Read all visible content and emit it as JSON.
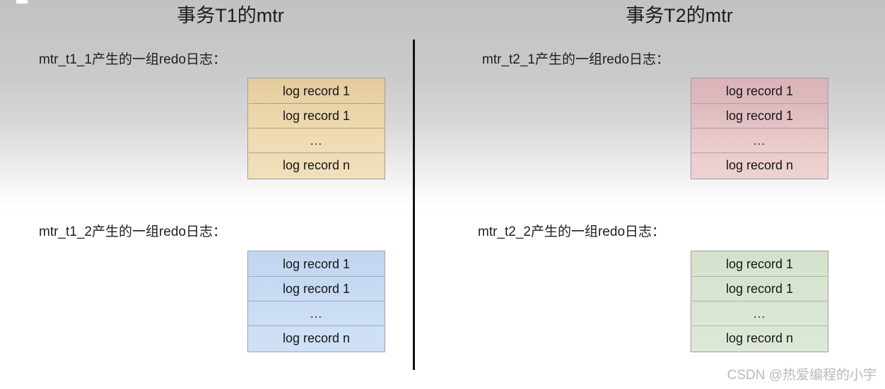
{
  "slide": {
    "background_top_color": "#c2c2c2",
    "background_bottom_color": "#ffffff",
    "divider_color": "#111111"
  },
  "columns": [
    {
      "id": "t1",
      "title": "事务T1的mtr",
      "groups": [
        {
          "id": "mtr_t1_1",
          "label": "mtr_t1_1产生的一组redo日志：",
          "color": "#edd6a8",
          "rows": [
            "log record 1",
            "log record 1",
            "...",
            "log record n"
          ]
        },
        {
          "id": "mtr_t1_2",
          "label": "mtr_t1_2产生的一组redo日志：",
          "color": "#c8dbf3",
          "rows": [
            "log record 1",
            "log record 1",
            "...",
            "log record n"
          ]
        }
      ]
    },
    {
      "id": "t2",
      "title": "事务T2的mtr",
      "groups": [
        {
          "id": "mtr_t2_1",
          "label": "mtr_t2_1产生的一组redo日志：",
          "color": "#e2c3c5",
          "rows": [
            "log record 1",
            "log record 1",
            "...",
            "log record n"
          ]
        },
        {
          "id": "mtr_t2_2",
          "label": "mtr_t2_2产生的一组redo日志：",
          "color": "#d8e5d2",
          "rows": [
            "log record 1",
            "log record 1",
            "...",
            "log record n"
          ]
        }
      ]
    }
  ],
  "watermark": "CSDN @热爱编程的小宇"
}
